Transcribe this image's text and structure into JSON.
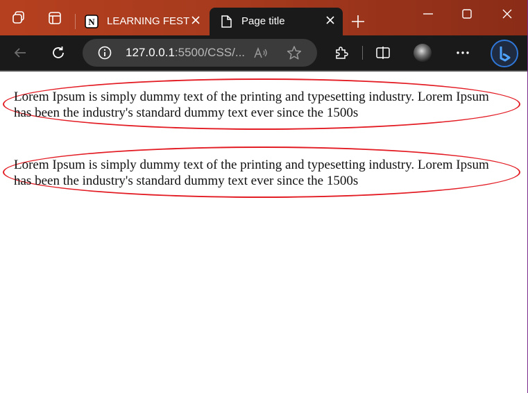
{
  "browser": {
    "tabs": [
      {
        "label": "LEARNING FEST",
        "icon": "notion-icon"
      },
      {
        "label": "Page title",
        "icon": "document-icon"
      }
    ],
    "address": {
      "host": "127.0.0.1",
      "rest": ":5500/CSS/..."
    },
    "colors": {
      "titlebar": "#a63a1d",
      "toolbar": "#1a1a1a",
      "accent": "#2f77d8"
    }
  },
  "page": {
    "paragraphs": [
      {
        "text": "Lorem Ipsum is simply dummy text of the printing and typesetting industry. Lorem Ipsum has been the industry's standard dummy text ever since the 1500s"
      },
      {
        "text": "Lorem Ipsum is simply dummy text of the printing and typesetting industry. Lorem Ipsum has been the industry's standard dummy text ever since the 1500s"
      }
    ],
    "colors": {
      "border": "#e31b23"
    }
  }
}
